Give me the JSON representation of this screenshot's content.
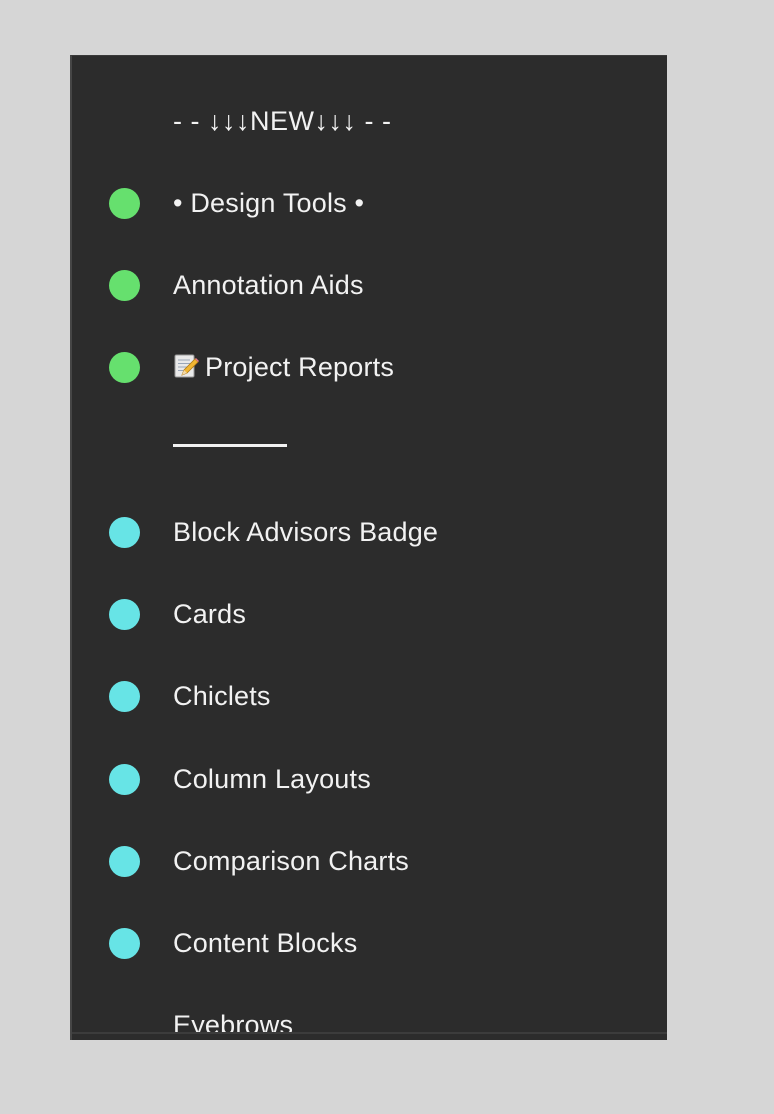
{
  "panel": {
    "background": "#2c2c2c",
    "status_colors": {
      "green": "#66e06e",
      "cyan": "#67e4e6"
    },
    "items": [
      {
        "label": "- - ↓↓↓NEW↓↓↓ - -",
        "status": null,
        "kind": "header"
      },
      {
        "label": "• Design Tools •",
        "status": "green",
        "kind": "item"
      },
      {
        "label": "Annotation Aids",
        "status": "green",
        "kind": "item"
      },
      {
        "label": "Project Reports",
        "status": "green",
        "kind": "item",
        "icon": "memo-pencil-icon"
      },
      {
        "label": "________",
        "status": null,
        "kind": "divider"
      },
      {
        "label": "Block Advisors Badge",
        "status": "cyan",
        "kind": "item"
      },
      {
        "label": "Cards",
        "status": "cyan",
        "kind": "item"
      },
      {
        "label": "Chiclets",
        "status": "cyan",
        "kind": "item"
      },
      {
        "label": "Column Layouts",
        "status": "cyan",
        "kind": "item"
      },
      {
        "label": "Comparison Charts",
        "status": "cyan",
        "kind": "item"
      },
      {
        "label": "Content Blocks",
        "status": "cyan",
        "kind": "item"
      },
      {
        "label": "Eyebrows",
        "status": null,
        "kind": "item"
      }
    ]
  }
}
